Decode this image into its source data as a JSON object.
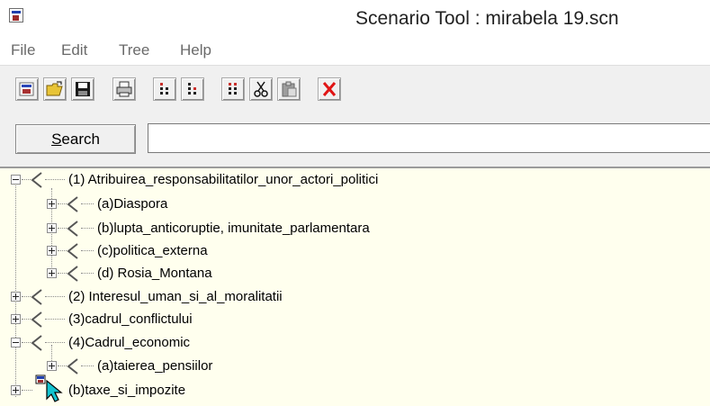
{
  "window": {
    "title": "Scenario Tool : mirabela 19.scn",
    "icon": "app-icon"
  },
  "menu": [
    {
      "label": "File"
    },
    {
      "label": "Edit"
    },
    {
      "label": "Tree"
    },
    {
      "label": "Help"
    }
  ],
  "toolbar": {
    "buttons": [
      {
        "icon": "new-scenario-icon"
      },
      {
        "icon": "open-folder-icon"
      },
      {
        "icon": "save-disk-icon"
      },
      {
        "icon": "print-icon"
      },
      {
        "icon": "add-sibling-node-icon"
      },
      {
        "icon": "add-child-node-icon"
      },
      {
        "icon": "insert-node-icon"
      },
      {
        "icon": "cut-icon"
      },
      {
        "icon": "paste-icon"
      },
      {
        "icon": "delete-icon"
      }
    ]
  },
  "search": {
    "button_prefix": "S",
    "button_rest": "earch",
    "value": "",
    "placeholder": ""
  },
  "tree": {
    "nodes": [
      {
        "label": "(1) Atribuirea_responsabilitatilor_unor_actori_politici",
        "level": 0,
        "expander": "minus"
      },
      {
        "label": "(a)Diaspora",
        "level": 1,
        "expander": "plus"
      },
      {
        "label": "(b)lupta_anticoruptie, imunitate_parlamentara",
        "level": 1,
        "expander": "plus"
      },
      {
        "label": "(c)politica_externa",
        "level": 1,
        "expander": "plus"
      },
      {
        "label": "(d) Rosia_Montana",
        "level": 1,
        "expander": "plus"
      },
      {
        "label": "(2) Interesul_uman_si_al_moralitatii",
        "level": 0,
        "expander": "plus"
      },
      {
        "label": "(3)cadrul_conflictului",
        "level": 0,
        "expander": "plus"
      },
      {
        "label": "(4)Cadrul_economic",
        "level": 0,
        "expander": "minus"
      },
      {
        "label": "(a)taierea_pensiilor",
        "level": 1,
        "expander": "plus"
      },
      {
        "label": "(b)taxe_si_impozite",
        "level": 0,
        "expander": "plus",
        "dragging": true
      }
    ]
  },
  "colors": {
    "tree_background": "#ffffee",
    "toolbar_background": "#f0f0f0"
  }
}
